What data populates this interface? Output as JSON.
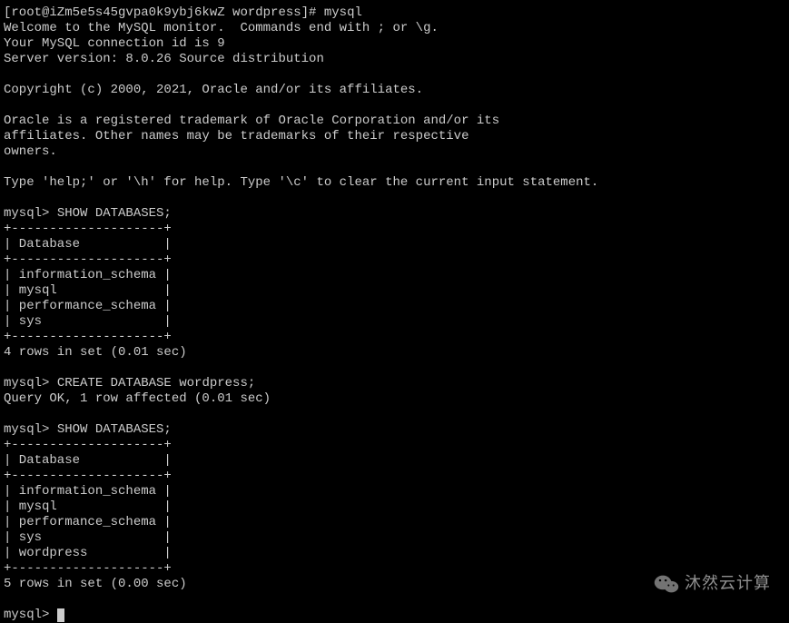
{
  "prompt_shell": "[root@iZm5e5s45gvpa0k9ybj6kwZ wordpress]# ",
  "command_mysql": "mysql",
  "welcome_lines": [
    "Welcome to the MySQL monitor.  Commands end with ; or \\g.",
    "Your MySQL connection id is 9",
    "Server version: 8.0.26 Source distribution",
    "",
    "Copyright (c) 2000, 2021, Oracle and/or its affiliates.",
    "",
    "Oracle is a registered trademark of Oracle Corporation and/or its",
    "affiliates. Other names may be trademarks of their respective",
    "owners.",
    "",
    "Type 'help;' or '\\h' for help. Type '\\c' to clear the current input statement.",
    ""
  ],
  "mysql_prompt": "mysql> ",
  "cmd_show_db1": "SHOW DATABASES;",
  "table1": {
    "border_top": "+--------------------+",
    "header_row": "| Database           |",
    "border_mid": "+--------------------+",
    "rows": [
      "| information_schema |",
      "| mysql              |",
      "| performance_schema |",
      "| sys                |"
    ],
    "border_bot": "+--------------------+",
    "summary": "4 rows in set (0.01 sec)"
  },
  "cmd_create_db": "CREATE DATABASE wordpress;",
  "create_result": "Query OK, 1 row affected (0.01 sec)",
  "cmd_show_db2": "SHOW DATABASES;",
  "table2": {
    "border_top": "+--------------------+",
    "header_row": "| Database           |",
    "border_mid": "+--------------------+",
    "rows": [
      "| information_schema |",
      "| mysql              |",
      "| performance_schema |",
      "| sys                |",
      "| wordpress          |"
    ],
    "border_bot": "+--------------------+",
    "summary": "5 rows in set (0.00 sec)"
  },
  "watermark": {
    "text": "沐然云计算"
  }
}
